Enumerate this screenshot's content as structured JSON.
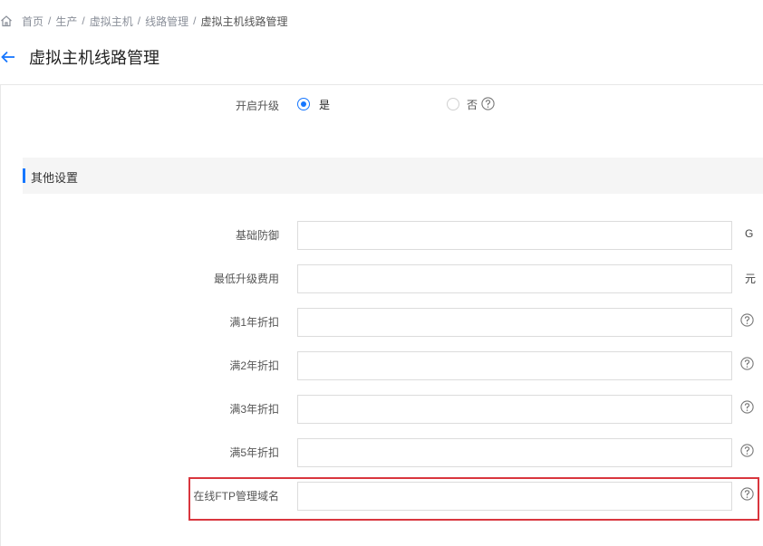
{
  "breadcrumb": {
    "items": [
      {
        "label": "首页"
      },
      {
        "label": "生产"
      },
      {
        "label": "虚拟主机"
      },
      {
        "label": "线路管理"
      },
      {
        "label": "虚拟主机线路管理"
      }
    ],
    "separator": "/"
  },
  "header": {
    "title": "虚拟主机线路管理"
  },
  "upgrade": {
    "label": "开启升级",
    "options": [
      {
        "label": "是",
        "selected": true
      },
      {
        "label": "否",
        "selected": false
      }
    ]
  },
  "section": {
    "title": "其他设置"
  },
  "fields": [
    {
      "label": "基础防御",
      "value": "",
      "unit": "G"
    },
    {
      "label": "最低升级费用",
      "value": "",
      "unit": "元"
    },
    {
      "label": "满1年折扣",
      "value": "",
      "icon": "help-icon"
    },
    {
      "label": "满2年折扣",
      "value": "",
      "icon": "help-icon"
    },
    {
      "label": "满3年折扣",
      "value": "",
      "icon": "help-icon"
    },
    {
      "label": "满5年折扣",
      "value": "",
      "icon": "help-icon"
    },
    {
      "label": "在线FTP管理域名",
      "value": "",
      "icon": "help-icon"
    }
  ],
  "colors": {
    "accent": "#1677ff",
    "highlight": "#d9363e",
    "section_bg": "#f5f5f5"
  }
}
